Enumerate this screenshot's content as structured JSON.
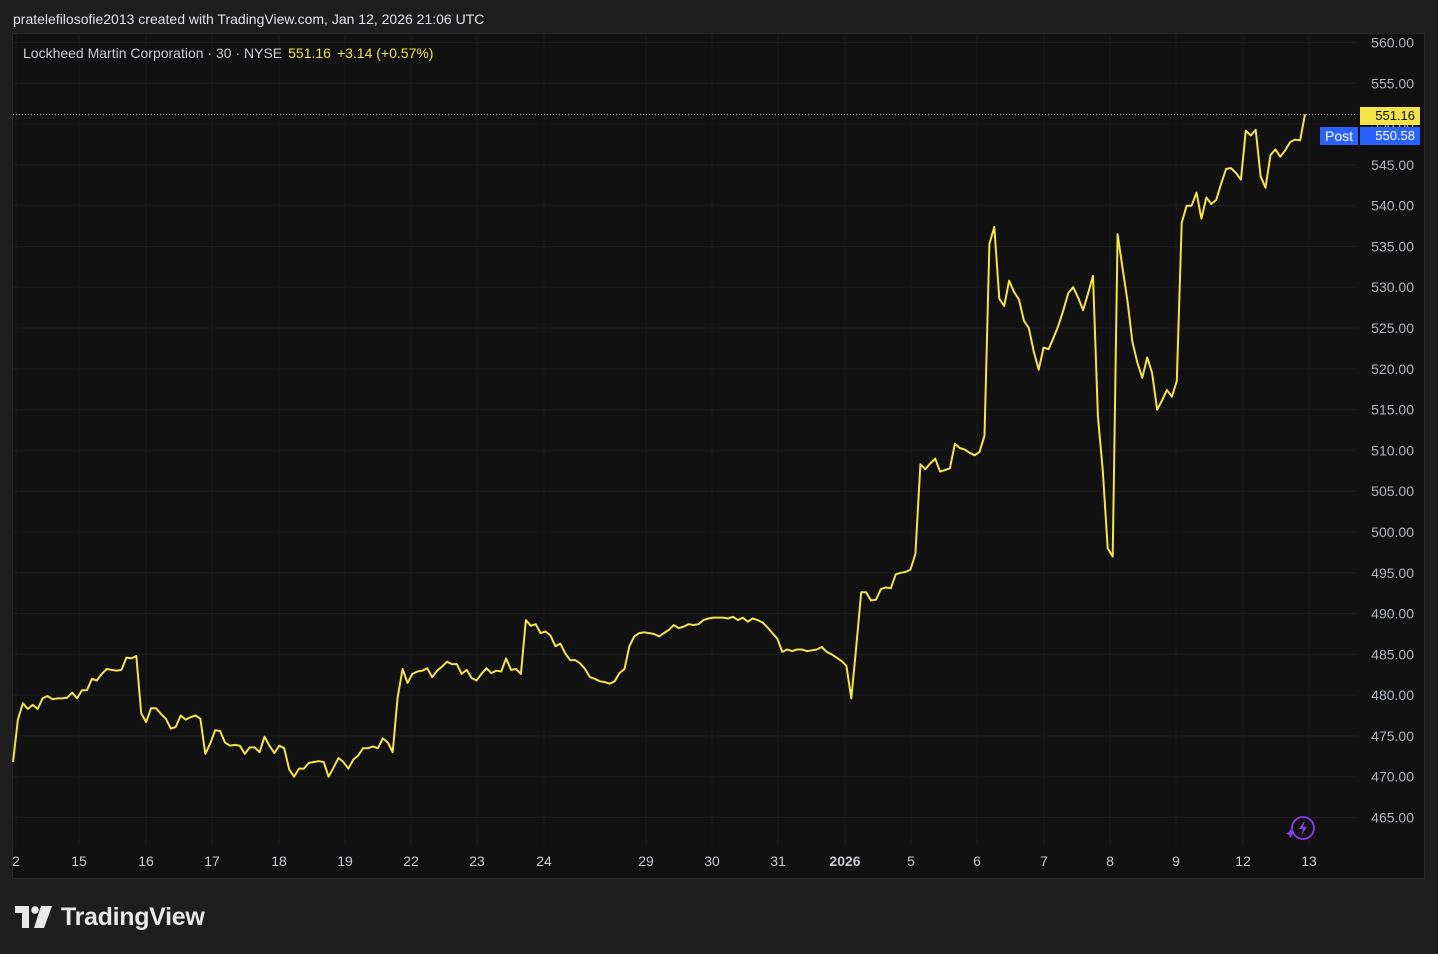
{
  "header": {
    "credit": "pratelefilosofie2013 created with TradingView.com, Jan 12, 2026 21:06 UTC"
  },
  "legend": {
    "symbol": "Lockheed Martin Corporation · 30 · NYSE",
    "last": "551.16",
    "change": "+3.14 (+0.57%)"
  },
  "price_tags": {
    "last": "551.16",
    "post_label": "Post",
    "post": "550.58"
  },
  "footer": {
    "brand": "TradingView"
  },
  "colors": {
    "line": "#f5e348",
    "background": "#111111",
    "grid": "#1c1c1c",
    "last_tag": "#f5e348",
    "post_tag": "#2962ff",
    "ai_icon": "#8e3cf0"
  },
  "icons": [
    "tradingview-logo-icon",
    "lightning-ai-icon"
  ],
  "chart_data": {
    "type": "line",
    "title": "",
    "xlabel": "",
    "ylabel": "",
    "ylim": [
      460.5,
      562
    ],
    "yticks": [
      "560.00",
      "555.00",
      "550.00",
      "545.00",
      "540.00",
      "535.00",
      "530.00",
      "525.00",
      "520.00",
      "515.00",
      "510.00",
      "505.00",
      "500.00",
      "495.00",
      "490.00",
      "485.00",
      "480.00",
      "475.00",
      "470.00",
      "465.00"
    ],
    "xticks": [
      "2",
      "15",
      "16",
      "17",
      "18",
      "19",
      "22",
      "23",
      "24",
      "29",
      "30",
      "31",
      "2026",
      "5",
      "6",
      "7",
      "8",
      "9",
      "12",
      "13"
    ],
    "grid": true,
    "series": [
      {
        "values": [
          471.8,
          477.0,
          479.0,
          478.3,
          478.8,
          478.3,
          479.6,
          479.9,
          479.5,
          479.6,
          479.6,
          479.7,
          480.3,
          479.6,
          480.6,
          480.6,
          482.0,
          481.8,
          482.6,
          483.2,
          483.1,
          483.0,
          483.1,
          484.6,
          484.5,
          484.8,
          477.8,
          476.7,
          478.4,
          478.4,
          477.7,
          477.1,
          475.9,
          476.1,
          477.5,
          477.0,
          477.3,
          477.5,
          477.1,
          472.8,
          474.1,
          475.7,
          475.6,
          474.2,
          473.8,
          473.9,
          473.8,
          472.8,
          473.6,
          473.6,
          473.0,
          474.9,
          473.8,
          472.9,
          473.8,
          473.5,
          470.9,
          470.0,
          471.0,
          471.0,
          471.7,
          471.8,
          471.9,
          471.8,
          470.0,
          471.1,
          472.3,
          471.8,
          471.0,
          472.1,
          472.6,
          473.5,
          473.5,
          473.7,
          473.5,
          474.7,
          474.2,
          473.0,
          479.7,
          483.2,
          481.5,
          482.6,
          482.9,
          483.0,
          483.3,
          482.2,
          483.0,
          483.5,
          484.1,
          483.8,
          483.8,
          482.6,
          483.1,
          482.1,
          481.8,
          482.6,
          483.3,
          482.7,
          483.0,
          482.9,
          484.5,
          483.1,
          483.2,
          482.6,
          489.2,
          488.5,
          488.7,
          487.6,
          487.8,
          487.3,
          486.0,
          486.3,
          485.1,
          484.3,
          484.3,
          483.9,
          483.2,
          482.2,
          482.0,
          481.7,
          481.6,
          481.4,
          481.7,
          482.7,
          483.2,
          486.0,
          487.2,
          487.6,
          487.7,
          487.6,
          487.5,
          487.2,
          487.6,
          488.0,
          488.6,
          488.2,
          488.4,
          488.7,
          488.6,
          488.7,
          489.2,
          489.4,
          489.5,
          489.5,
          489.5,
          489.4,
          489.6,
          489.2,
          489.5,
          489.0,
          489.4,
          489.2,
          488.9,
          488.3,
          487.6,
          486.9,
          485.3,
          485.6,
          485.4,
          485.6,
          485.6,
          485.4,
          485.5,
          485.6,
          485.9,
          485.3,
          485.0,
          484.6,
          484.2,
          483.6,
          479.6,
          486.0,
          492.6,
          492.6,
          491.6,
          491.7,
          493.0,
          493.2,
          493.1,
          494.8,
          495.0,
          495.1,
          495.4,
          497.3,
          508.3,
          507.7,
          508.4,
          509.0,
          507.4,
          507.6,
          507.8,
          510.8,
          510.3,
          510.1,
          509.7,
          509.4,
          509.8,
          511.8,
          535.3,
          537.4,
          528.6,
          527.7,
          530.8,
          529.4,
          528.5,
          525.9,
          525.0,
          522.1,
          519.9,
          522.6,
          522.4,
          523.8,
          525.3,
          527.2,
          529.3,
          530.0,
          528.7,
          527.2,
          529.2,
          531.4,
          514.2,
          507.5,
          498.0,
          497.0,
          536.5,
          532.4,
          528.3,
          523.3,
          520.8,
          518.9,
          521.4,
          519.5,
          515.0,
          516.1,
          517.4,
          516.6,
          518.5,
          537.9,
          540.0,
          540.0,
          541.6,
          538.4,
          541.0,
          540.2,
          540.7,
          542.7,
          544.5,
          544.6,
          544.0,
          543.2,
          549.2,
          548.6,
          549.3,
          543.6,
          542.2,
          546.2,
          546.9,
          546.0,
          546.8,
          547.8,
          548.1,
          548.0,
          551.2
        ]
      }
    ],
    "last_price": 551.16,
    "post_price": 550.58
  }
}
